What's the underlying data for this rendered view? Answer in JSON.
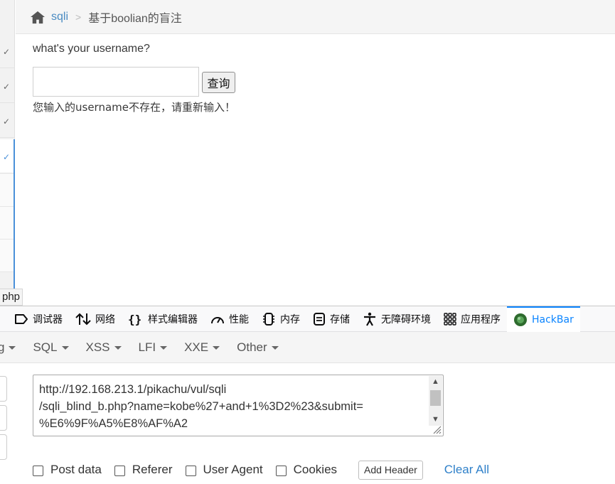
{
  "breadcrumb": {
    "home_icon": "home-icon",
    "section_link": "sqli",
    "separator": ">",
    "current": "基于boolian的盲注"
  },
  "form": {
    "question": "what's your username?",
    "username_value": "",
    "query_button": "查询",
    "result_message": "您输入的username不存在，请重新输入！"
  },
  "status_url_fragment": "php",
  "devtools": {
    "tabs": [
      {
        "label": "调试器",
        "icon": "debugger-icon"
      },
      {
        "label": "网络",
        "icon": "network-arrows-icon"
      },
      {
        "label": "样式编辑器",
        "icon": "braces-icon"
      },
      {
        "label": "性能",
        "icon": "gauge-icon"
      },
      {
        "label": "内存",
        "icon": "memory-chip-icon"
      },
      {
        "label": "存储",
        "icon": "storage-icon"
      },
      {
        "label": "无障碍环境",
        "icon": "accessibility-icon"
      },
      {
        "label": "应用程序",
        "icon": "grid-apps-icon"
      },
      {
        "label": "HackBar",
        "icon": "hackbar-logo-icon"
      }
    ],
    "selected_tab": "HackBar",
    "accent_color": "#0a84ff"
  },
  "hackbar": {
    "menu": [
      {
        "label": "g"
      },
      {
        "label": "SQL"
      },
      {
        "label": "XSS"
      },
      {
        "label": "LFI"
      },
      {
        "label": "XXE"
      },
      {
        "label": "Other"
      }
    ],
    "url_lines": [
      "http://192.168.213.1/pikachu/vul/sqli",
      "/sqli_blind_b.php?name=kobe%27+and+1%3D2%23&submit=",
      "%E6%9F%A5%E8%AF%A2"
    ],
    "options": {
      "post_data": "Post data",
      "referer": "Referer",
      "user_agent": "User Agent",
      "cookies": "Cookies"
    },
    "add_header": "Add Header",
    "clear_all": "Clear All",
    "link_color": "#2f80c9"
  }
}
